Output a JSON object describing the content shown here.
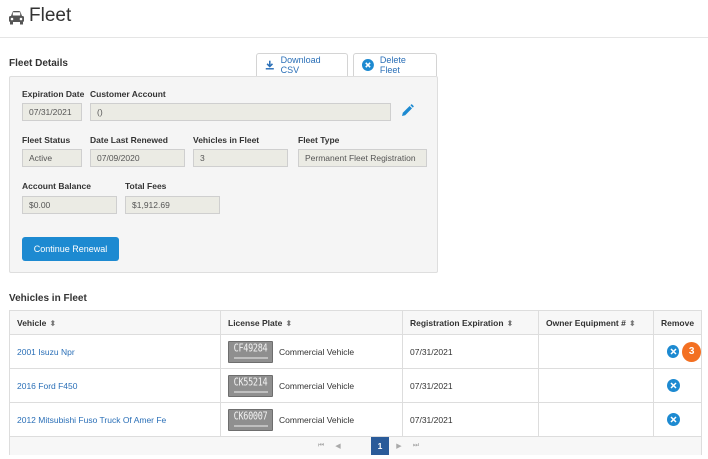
{
  "page": {
    "title": "Fleet",
    "icon": "car-icon"
  },
  "fleet_details": {
    "title": "Fleet Details",
    "download_csv_label": "Download CSV",
    "delete_fleet_label": "Delete Fleet",
    "expiration_date": {
      "label": "Expiration Date",
      "value": "07/31/2021"
    },
    "customer_account": {
      "label": "Customer Account",
      "value": "()"
    },
    "fleet_status": {
      "label": "Fleet Status",
      "value": "Active"
    },
    "date_last_renewed": {
      "label": "Date Last Renewed",
      "value": "07/09/2020"
    },
    "vehicles_in_fleet": {
      "label": "Vehicles in Fleet",
      "value": "3"
    },
    "fleet_type": {
      "label": "Fleet Type",
      "value": "Permanent Fleet Registration"
    },
    "account_balance": {
      "label": "Account Balance",
      "value": "$0.00"
    },
    "total_fees": {
      "label": "Total Fees",
      "value": "$1,912.69"
    },
    "continue_renewal_label": "Continue Renewal"
  },
  "vehicles": {
    "title": "Vehicles in Fleet",
    "columns": [
      "Vehicle",
      "License Plate",
      "Registration Expiration",
      "Owner Equipment #",
      "Remove"
    ],
    "rows": [
      {
        "vehicle": "2001 Isuzu Npr",
        "plate": "CF49284",
        "plate_type": "Commercial Vehicle",
        "expiration": "07/31/2021",
        "owner_equipment": ""
      },
      {
        "vehicle": "2016 Ford F450",
        "plate": "CK55214",
        "plate_type": "Commercial Vehicle",
        "expiration": "07/31/2021",
        "owner_equipment": ""
      },
      {
        "vehicle": "2012 Mitsubishi Fuso Truck Of Amer Fe",
        "plate": "CK60007",
        "plate_type": "Commercial Vehicle",
        "expiration": "07/31/2021",
        "owner_equipment": ""
      }
    ],
    "badge": "3",
    "pager": {
      "current_page": "1",
      "first": "⏮",
      "prev": "◀",
      "next": "▶",
      "last": "⏭"
    }
  },
  "colors": {
    "accent": "#1d8ad1",
    "link": "#2a6fb7",
    "badge": "#f37022",
    "pager_active": "#2a5b99"
  }
}
